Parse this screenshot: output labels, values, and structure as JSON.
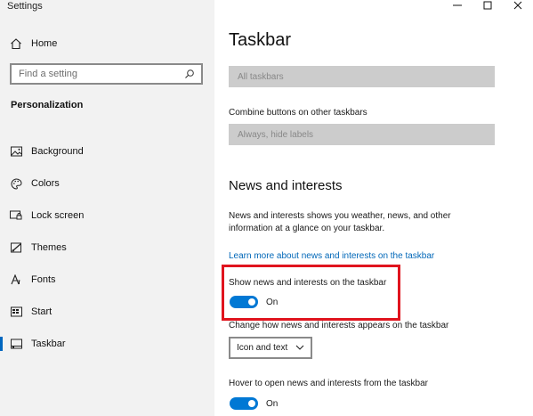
{
  "window": {
    "title": "Settings",
    "controls": [
      "minimize",
      "maximize",
      "close"
    ]
  },
  "sidebar": {
    "home_label": "Home",
    "search": {
      "placeholder": "Find a setting"
    },
    "section_heading": "Personalization",
    "items": [
      {
        "label": "Background",
        "icon": "image-icon"
      },
      {
        "label": "Colors",
        "icon": "palette-icon"
      },
      {
        "label": "Lock screen",
        "icon": "lock-screen-icon"
      },
      {
        "label": "Themes",
        "icon": "themes-icon"
      },
      {
        "label": "Fonts",
        "icon": "fonts-icon"
      },
      {
        "label": "Start",
        "icon": "start-icon"
      },
      {
        "label": "Taskbar",
        "icon": "taskbar-icon",
        "active": true
      }
    ]
  },
  "main": {
    "title": "Taskbar",
    "taskbars_dropdown": {
      "value": "All taskbars",
      "disabled": true
    },
    "combine_label": "Combine buttons on other taskbars",
    "combine_dropdown": {
      "value": "Always, hide labels",
      "disabled": true
    },
    "news_heading": "News and interests",
    "news_description": "News and interests shows you weather, news, and other information at a glance on your taskbar.",
    "learn_more_link": "Learn more about news and interests on the taskbar",
    "show_news": {
      "label": "Show news and interests on the taskbar",
      "state_text": "On",
      "on": true
    },
    "change_appearance": {
      "label": "Change how news and interests appears on the taskbar",
      "value": "Icon and text"
    },
    "hover_open": {
      "label": "Hover to open news and interests from the taskbar",
      "state_text": "On",
      "on": true
    }
  },
  "colors": {
    "accent": "#0078d4",
    "link": "#0067b8",
    "highlight": "#e0141e",
    "sidebar_bg": "#f2f2f2",
    "disabled_dropdown": "#cccccc"
  }
}
